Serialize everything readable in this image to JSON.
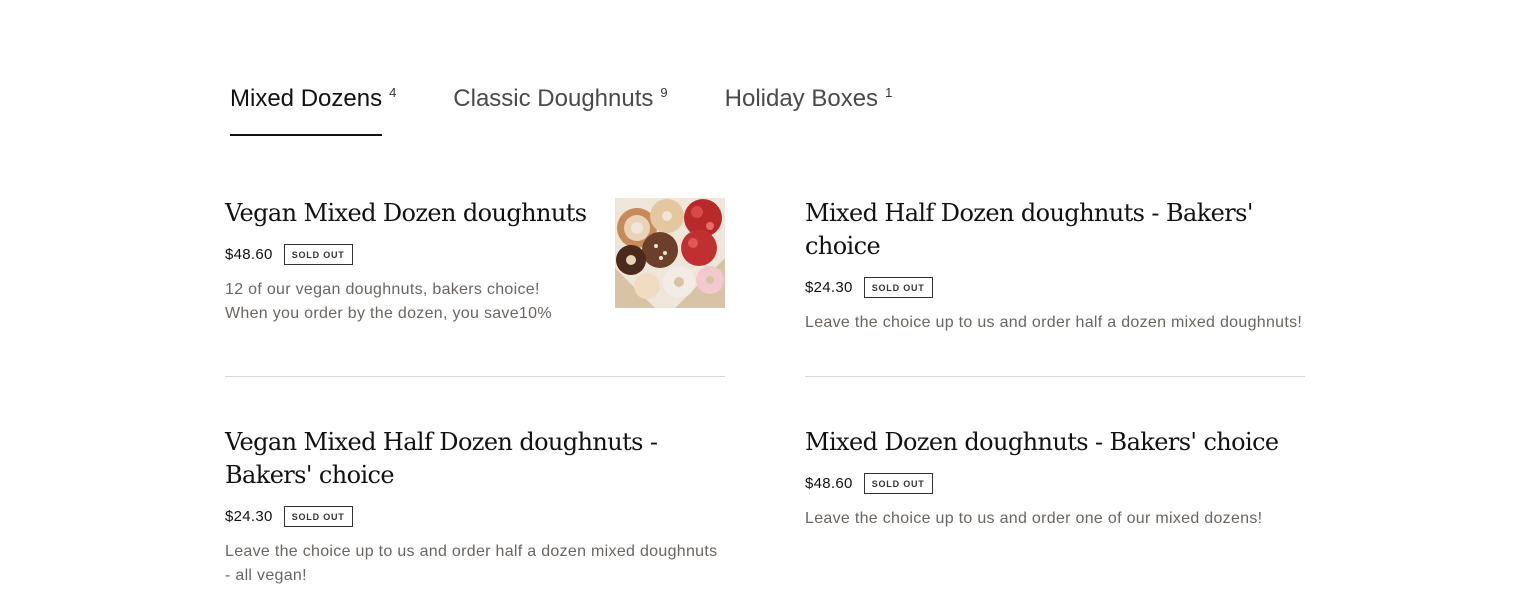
{
  "tabs": [
    {
      "label": "Mixed Dozens",
      "count": "4",
      "active": true
    },
    {
      "label": "Classic Doughnuts",
      "count": "9",
      "active": false
    },
    {
      "label": "Holiday Boxes",
      "count": "1",
      "active": false
    }
  ],
  "items": [
    {
      "title": "Vegan Mixed Dozen doughnuts",
      "price": "$48.60",
      "badge": "SOLD OUT",
      "description": "12 of our vegan doughnuts, bakers choice! When you order by the dozen, you save10%",
      "image": "doughnut-box-photo"
    },
    {
      "title": "Mixed Half Dozen doughnuts - Bakers' choice",
      "price": "$24.30",
      "badge": "SOLD OUT",
      "description": "Leave the choice up to us and order half a dozen mixed doughnuts!"
    },
    {
      "title": "Vegan Mixed Half Dozen doughnuts - Bakers' choice",
      "price": "$24.30",
      "badge": "SOLD OUT",
      "description": "Leave the choice up to us and order half a dozen mixed doughnuts - all vegan!"
    },
    {
      "title": "Mixed Dozen doughnuts - Bakers' choice",
      "price": "$48.60",
      "badge": "SOLD OUT",
      "description": "Leave the choice up to us and order one of our mixed dozens!"
    }
  ],
  "colors": {
    "text": "#111111",
    "muted_text": "#6a6560",
    "divider": "#d9d9d9",
    "active_tab_underline": "#111111"
  }
}
